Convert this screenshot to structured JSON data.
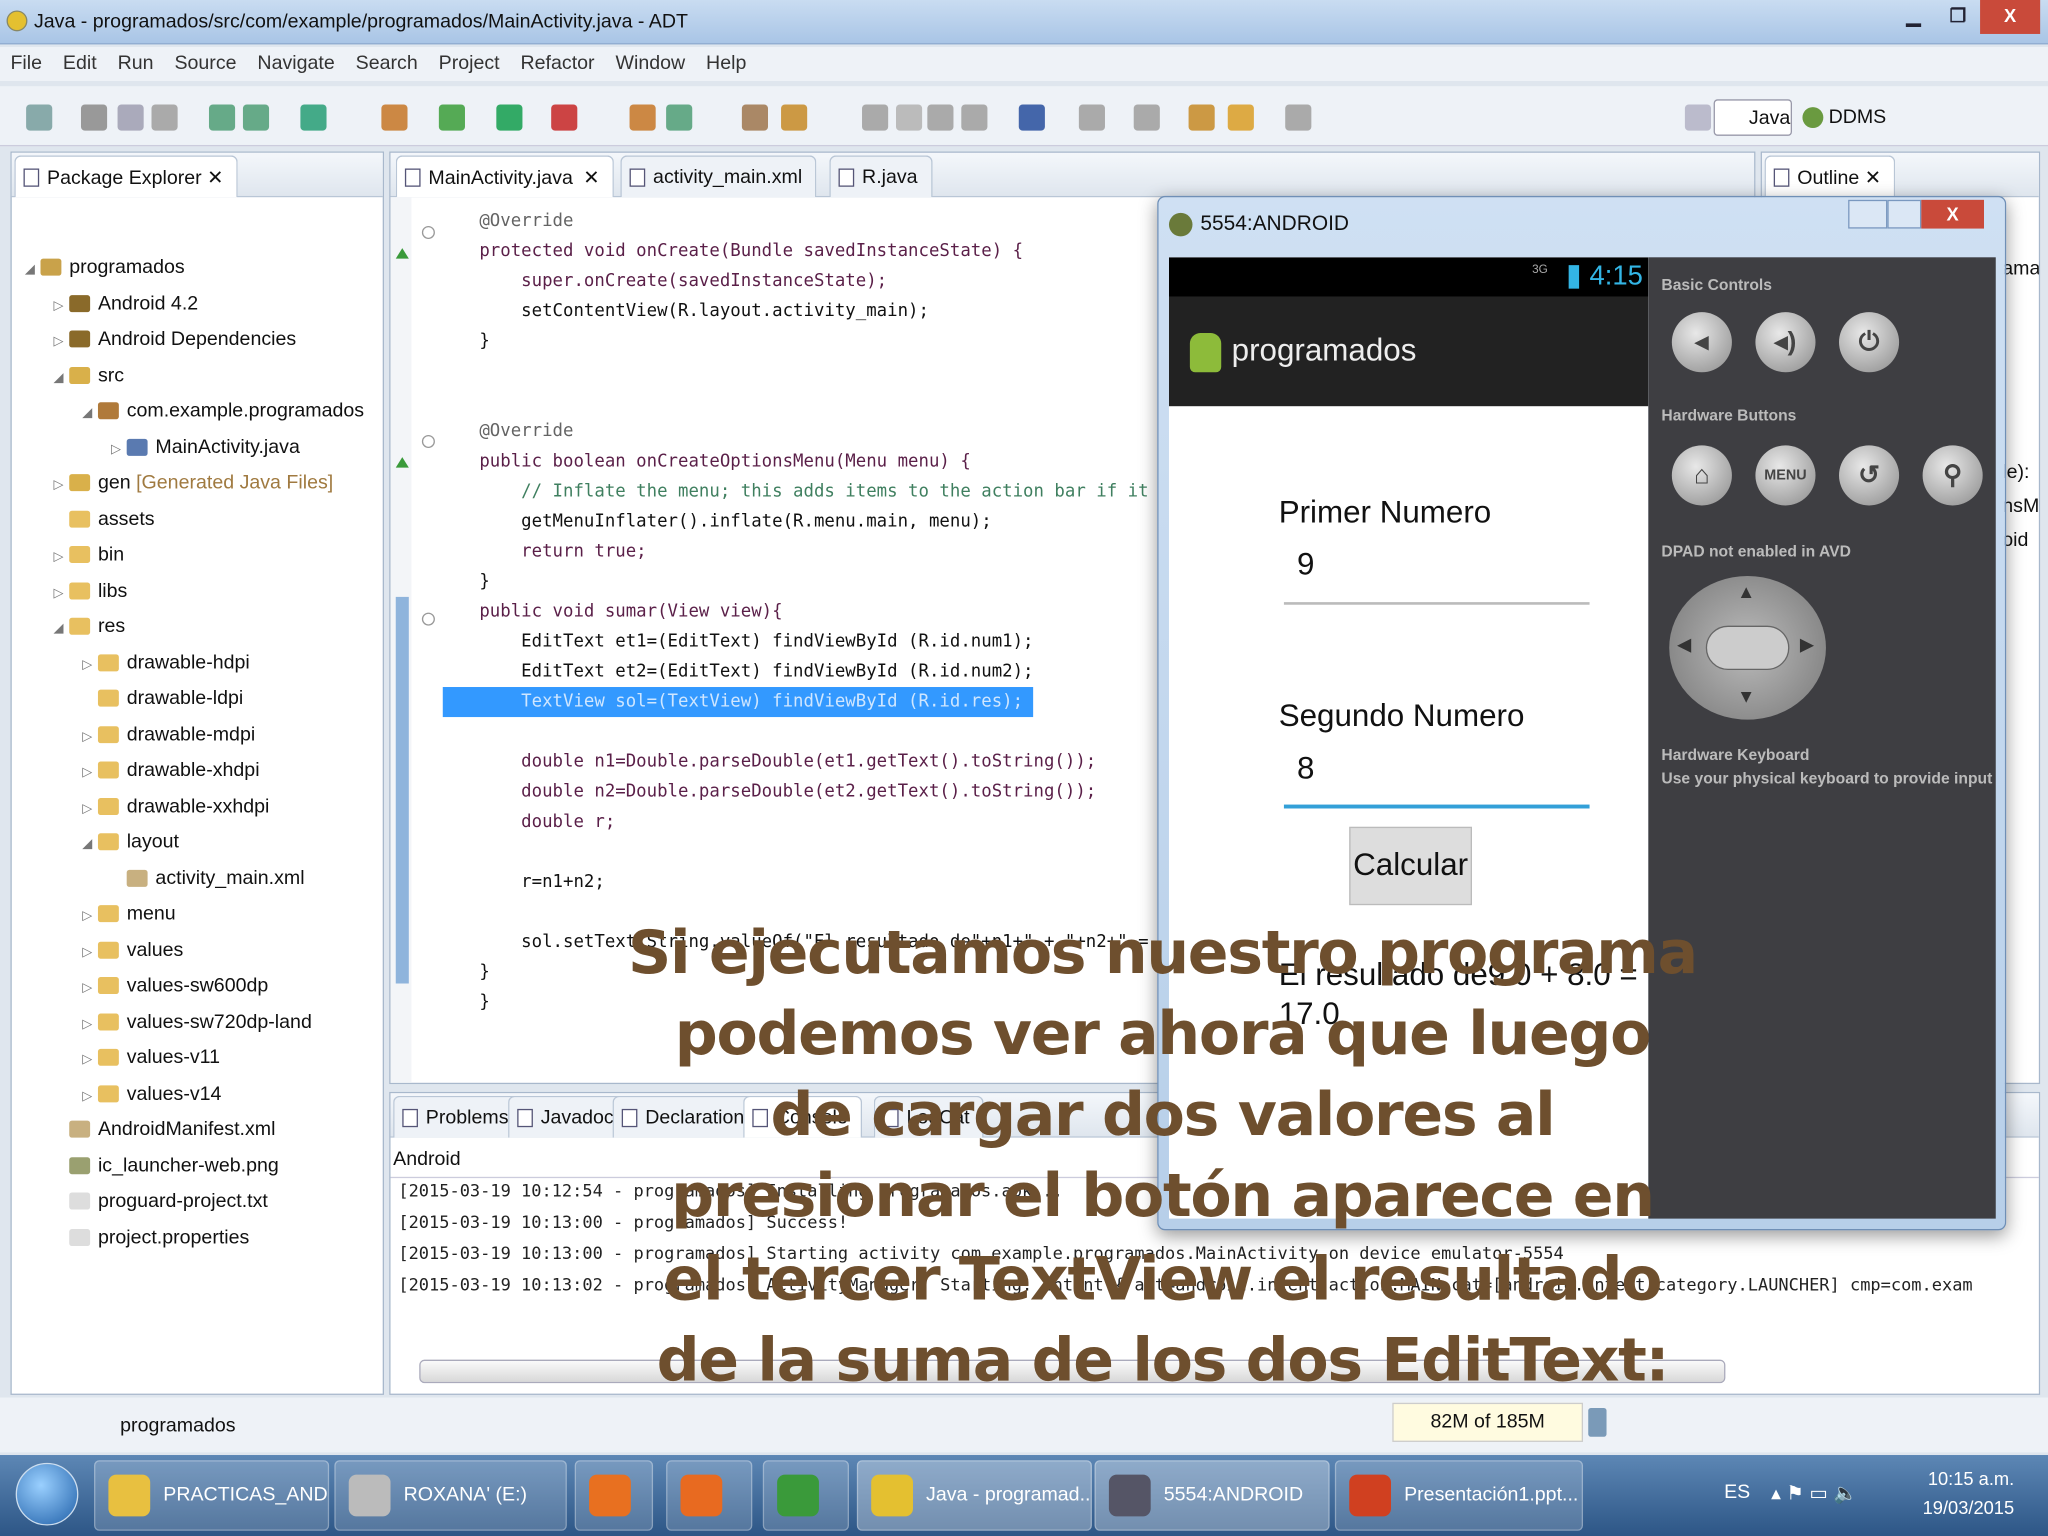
{
  "window": {
    "title": "Java - programados/src/com/example/programados/MainActivity.java - ADT",
    "min": "▁",
    "max": "❐",
    "close": "X"
  },
  "menu": [
    "File",
    "Edit",
    "Run",
    "Source",
    "Navigate",
    "Search",
    "Project",
    "Refactor",
    "Window",
    "Help"
  ],
  "perspectives": {
    "java": "Java",
    "ddms": "DDMS"
  },
  "package_explorer": {
    "title": "Package Explorer",
    "items": [
      {
        "label": "programados",
        "level": 0,
        "arrow": "◢",
        "color": "#c9a24a"
      },
      {
        "label": "Android 4.2",
        "level": 1,
        "arrow": "▷",
        "color": "#8a6a2a"
      },
      {
        "label": "Android Dependencies",
        "level": 1,
        "arrow": "▷",
        "color": "#8a6a2a"
      },
      {
        "label": "src",
        "level": 1,
        "arrow": "◢",
        "color": "#d9b04a"
      },
      {
        "label": "com.example.programados",
        "level": 2,
        "arrow": "◢",
        "color": "#b07a3a"
      },
      {
        "label": "MainActivity.java",
        "level": 3,
        "arrow": "▷",
        "color": "#5a7ab0"
      },
      {
        "label": "gen",
        "suffix": "[Generated Java Files]",
        "level": 1,
        "arrow": "▷",
        "color": "#d9b04a"
      },
      {
        "label": "assets",
        "level": 1,
        "arrow": "",
        "color": "#e8c060"
      },
      {
        "label": "bin",
        "level": 1,
        "arrow": "▷",
        "color": "#e8c060"
      },
      {
        "label": "libs",
        "level": 1,
        "arrow": "▷",
        "color": "#e8c060"
      },
      {
        "label": "res",
        "level": 1,
        "arrow": "◢",
        "color": "#e8c060"
      },
      {
        "label": "drawable-hdpi",
        "level": 2,
        "arrow": "▷",
        "color": "#e8c060"
      },
      {
        "label": "drawable-ldpi",
        "level": 2,
        "arrow": "",
        "color": "#e8c060"
      },
      {
        "label": "drawable-mdpi",
        "level": 2,
        "arrow": "▷",
        "color": "#e8c060"
      },
      {
        "label": "drawable-xhdpi",
        "level": 2,
        "arrow": "▷",
        "color": "#e8c060"
      },
      {
        "label": "drawable-xxhdpi",
        "level": 2,
        "arrow": "▷",
        "color": "#e8c060"
      },
      {
        "label": "layout",
        "level": 2,
        "arrow": "◢",
        "color": "#e8c060"
      },
      {
        "label": "activity_main.xml",
        "level": 3,
        "arrow": "",
        "color": "#c8b080"
      },
      {
        "label": "menu",
        "level": 2,
        "arrow": "▷",
        "color": "#e8c060"
      },
      {
        "label": "values",
        "level": 2,
        "arrow": "▷",
        "color": "#e8c060"
      },
      {
        "label": "values-sw600dp",
        "level": 2,
        "arrow": "▷",
        "color": "#e8c060"
      },
      {
        "label": "values-sw720dp-land",
        "level": 2,
        "arrow": "▷",
        "color": "#e8c060"
      },
      {
        "label": "values-v11",
        "level": 2,
        "arrow": "▷",
        "color": "#e8c060"
      },
      {
        "label": "values-v14",
        "level": 2,
        "arrow": "▷",
        "color": "#e8c060"
      },
      {
        "label": "AndroidManifest.xml",
        "level": 1,
        "arrow": "",
        "color": "#c8b080"
      },
      {
        "label": "ic_launcher-web.png",
        "level": 1,
        "arrow": "",
        "color": "#9aa070"
      },
      {
        "label": "proguard-project.txt",
        "level": 1,
        "arrow": "",
        "color": "#ddd"
      },
      {
        "label": "project.properties",
        "level": 1,
        "arrow": "",
        "color": "#ddd"
      }
    ]
  },
  "editor": {
    "tabs": [
      "MainActivity.java",
      "activity_main.xml",
      "R.java"
    ],
    "lines": [
      "@Override",
      "protected void onCreate(Bundle savedInstanceState) {",
      "    super.onCreate(savedInstanceState);",
      "    setContentView(R.layout.activity_main);",
      "}",
      "",
      "",
      "@Override",
      "public boolean onCreateOptionsMenu(Menu menu) {",
      "    // Inflate the menu; this adds items to the action bar if it",
      "    getMenuInflater().inflate(R.menu.main, menu);",
      "    return true;",
      "}",
      "public void sumar(View view){",
      "    EditText et1=(EditText) findViewById (R.id.num1);",
      "    EditText et2=(EditText) findViewById (R.id.num2);",
      "    TextView sol=(TextView) findViewById (R.id.res);",
      "",
      "    double n1=Double.parseDouble(et1.getText().toString());",
      "    double n2=Double.parseDouble(et2.getText().toString());",
      "    double r;",
      "",
      "    r=n1+n2;",
      "",
      "    sol.setText(String.valueOf(\"El resultado de\"+n1+\" + \"+n2+\" =",
      "}",
      "}"
    ],
    "highlight_line": 16
  },
  "outline": {
    "title": "Outline",
    "peek": [
      "ama",
      "le):",
      "nsM",
      "oid"
    ]
  },
  "bottom": {
    "tabs": [
      "Problems",
      "Javadoc",
      "Declaration",
      "Console",
      "LogCat"
    ],
    "console_name": "Android",
    "lines": [
      "[2015-03-19 10:12:54 - programados] Installing programados.apk...",
      "[2015-03-19 10:13:00 - programados] Success!",
      "[2015-03-19 10:13:00 - programados] Starting activity com.example.programados.MainActivity on device emulator-5554",
      "[2015-03-19 10:13:02 - programados] ActivityManager: Starting: Intent { act=android.intent.action.MAIN cat=[android.intent.category.LAUNCHER] cmp=com.exam"
    ]
  },
  "status": {
    "project": "programados",
    "memory": "82M of 185M"
  },
  "emulator": {
    "title": "5554:ANDROID",
    "time": "4:15",
    "net": "3G",
    "app_title": "programados",
    "label1": "Primer Numero",
    "value1": "9",
    "label2": "Segundo Numero",
    "value2": "8",
    "button": "Calcular",
    "result_line1": "El resultado de9.0 + 8.0 =",
    "result_line2": "17.0",
    "basic_controls": "Basic Controls",
    "hardware_buttons": "Hardware Buttons",
    "menu_btn": "MENU",
    "dpad": "DPAD not enabled in AVD",
    "keyboard_title": "Hardware Keyboard",
    "keyboard_text": "Use your physical keyboard to provide input"
  },
  "overlay": [
    "Si ejecutamos nuestro programa",
    "podemos ver ahora que luego",
    "de cargar dos valores al",
    "presionar el botón aparece en",
    "el tercer TextView el resultado",
    "de la suma de los dos EditText:"
  ],
  "taskbar": {
    "items": [
      "PRACTICAS_AND...",
      "ROXANA' (E:)",
      "",
      "",
      "",
      "Java - programad...",
      "5554:ANDROID",
      "Presentación1.ppt..."
    ],
    "lang": "ES",
    "time": "10:15 a.m.",
    "date": "19/03/2015"
  },
  "colors": {
    "overlay": "#6e4f2e",
    "selection": "#3399ff",
    "emu_accent": "#33b5e5"
  }
}
